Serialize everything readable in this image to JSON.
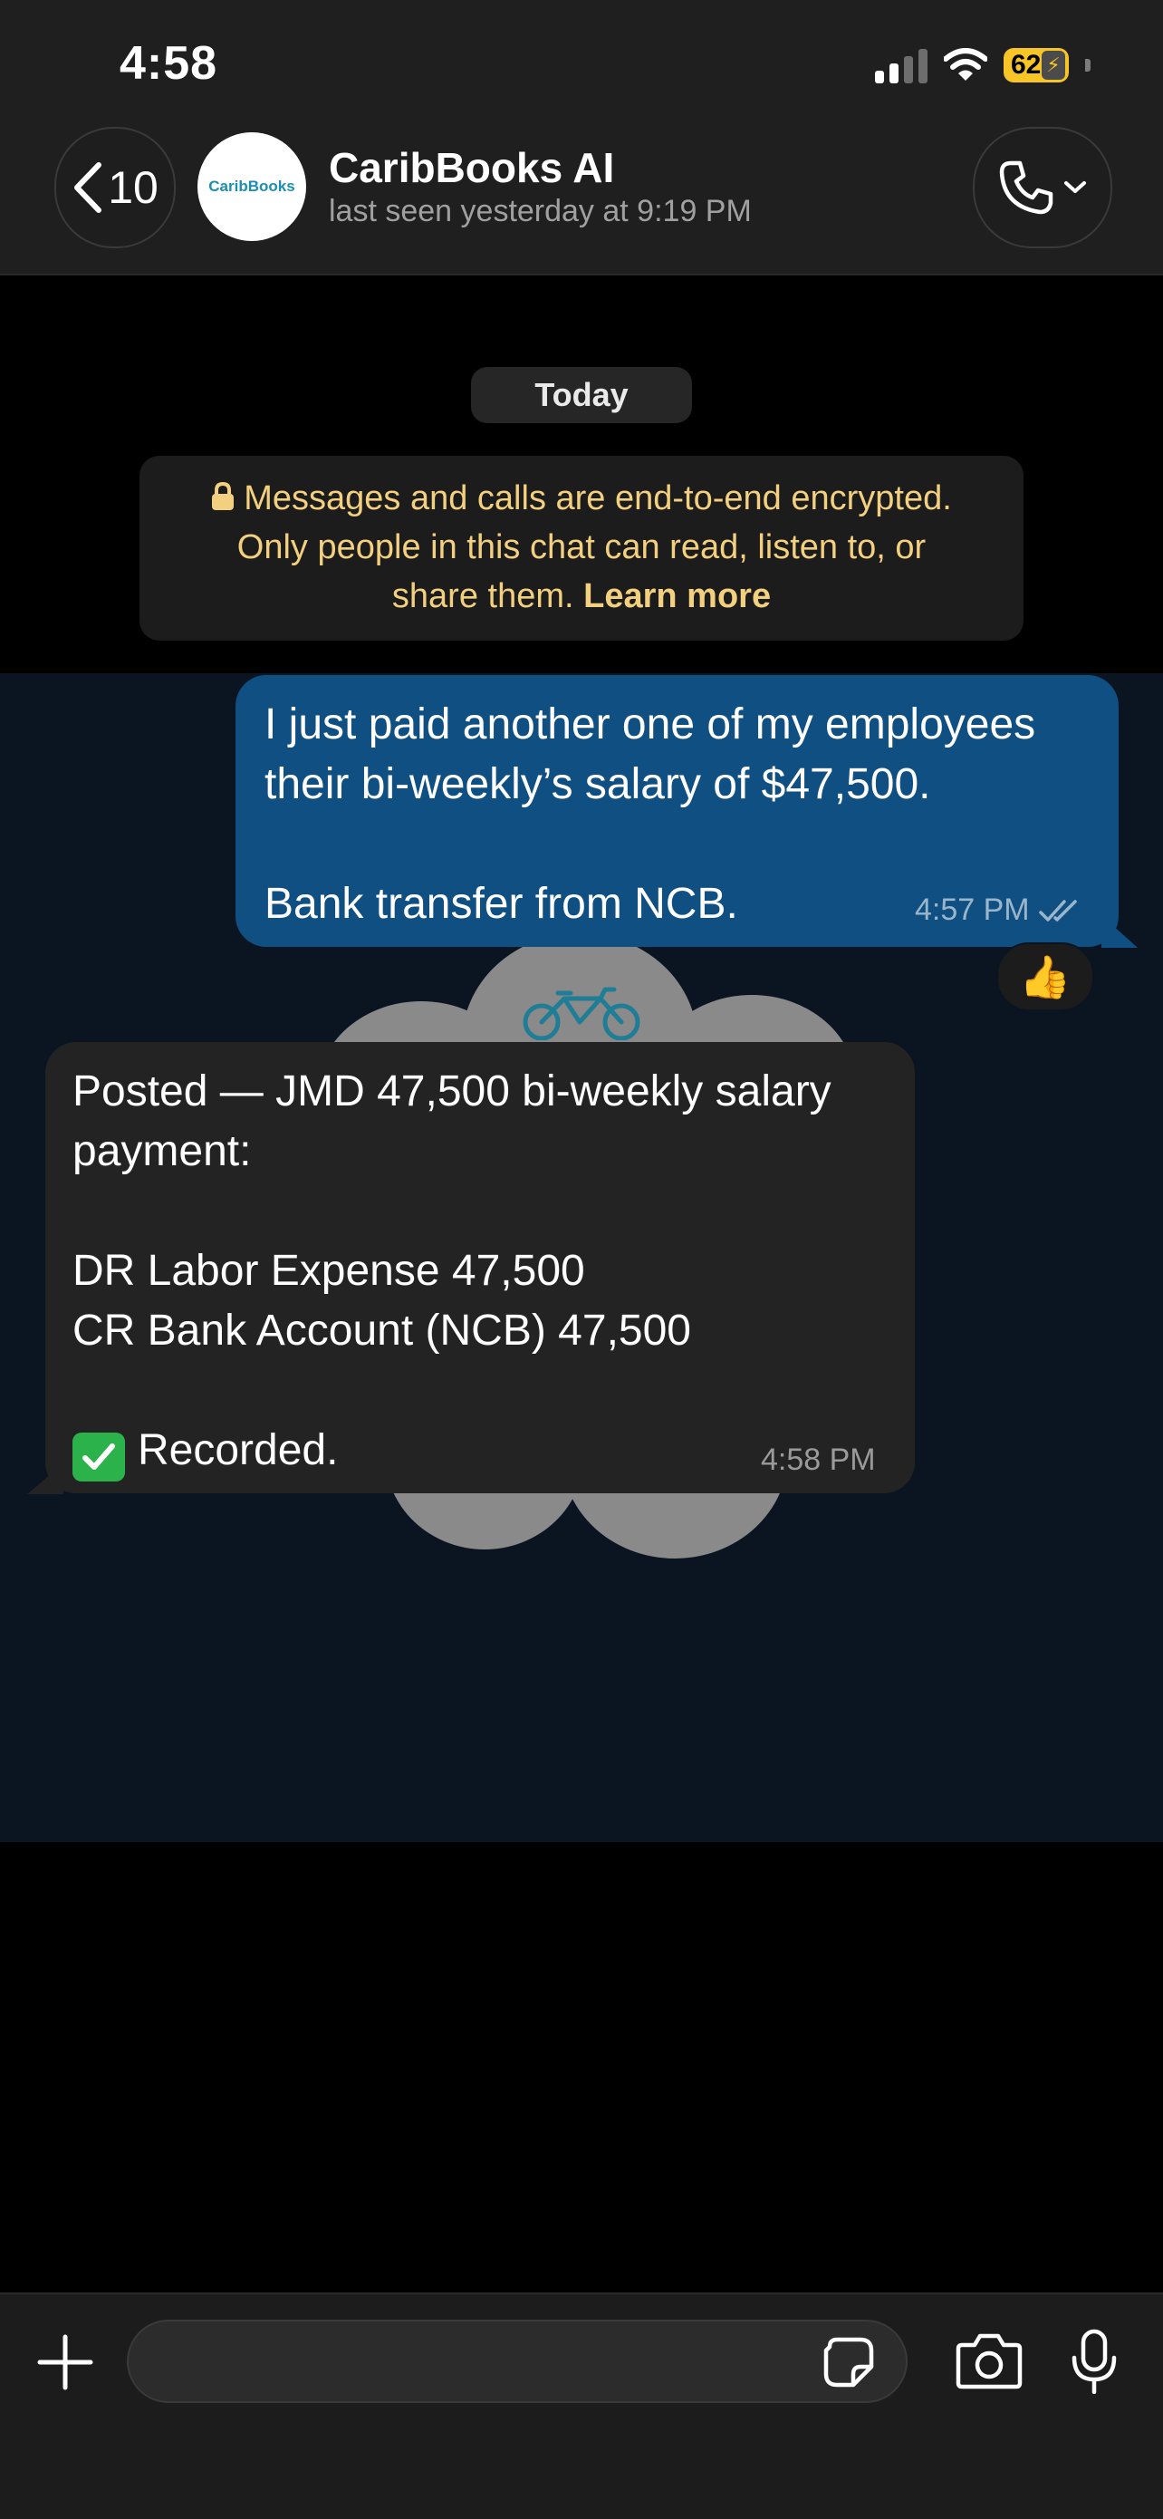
{
  "status_bar": {
    "time": "4:58",
    "battery": "62"
  },
  "header": {
    "back_count": "10",
    "avatar_text": "CaribBooks",
    "title": "CaribBooks AI",
    "subtitle": "last seen yesterday at 9:19 PM"
  },
  "chat": {
    "day_label": "Today",
    "encryption": {
      "line1": "Messages and calls are end-to-end encrypted.",
      "line2": "Only people in this chat can read, listen to, or",
      "line3": "share them.",
      "link": "Learn more"
    },
    "messages": [
      {
        "direction": "outgoing",
        "lines": [
          "I just paid another one of my employees",
          "their bi-weekly’s salary of $47,500.",
          "",
          "Bank transfer from NCB."
        ],
        "time": "4:57 PM",
        "reaction": "👍"
      },
      {
        "direction": "incoming",
        "lines": [
          "Posted — JMD 47,500 bi-weekly salary",
          "payment:",
          "",
          "DR Labor Expense  47,500",
          "CR Bank Account (NCB)  47,500",
          ""
        ],
        "final_line": "Recorded.",
        "time": "4:58 PM"
      }
    ]
  },
  "input_bar": {
    "placeholder": ""
  },
  "colors": {
    "outgoing_bubble": "#0f4f82",
    "incoming_bubble": "#232323",
    "battery": "#f7c525",
    "encryption_text": "#f3d07f"
  }
}
